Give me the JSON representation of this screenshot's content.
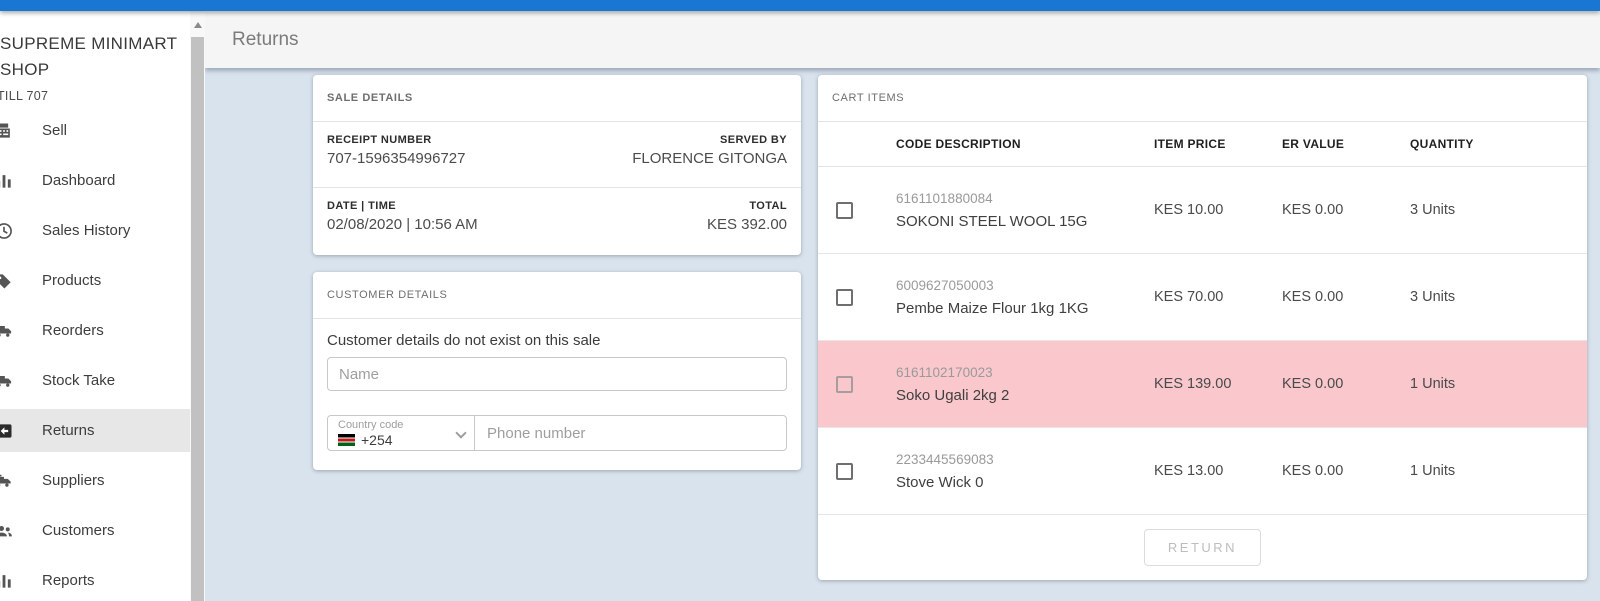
{
  "colors": {
    "topbar_blue": "#1976d2",
    "content_background": "#d9e3ee",
    "highlight_row_pink": "#f9c7cc",
    "active_nav_gray": "#e7e7e7"
  },
  "sidebar": {
    "store_name_line1": "SUPREME MINIMART",
    "store_name_line2": "SHOP",
    "till": "TILL 707",
    "items": [
      {
        "label": "Sell",
        "icon": "receipt-icon"
      },
      {
        "label": "Dashboard",
        "icon": "bar-chart-icon"
      },
      {
        "label": "Sales History",
        "icon": "clock-icon"
      },
      {
        "label": "Products",
        "icon": "tag-icon"
      },
      {
        "label": "Reorders",
        "icon": "truck-icon"
      },
      {
        "label": "Stock Take",
        "icon": "truck-icon"
      },
      {
        "label": "Returns",
        "icon": "return-box-icon",
        "active": true
      },
      {
        "label": "Suppliers",
        "icon": "truck-icon"
      },
      {
        "label": "Customers",
        "icon": "people-icon"
      },
      {
        "label": "Reports",
        "icon": "bar-chart-icon"
      }
    ]
  },
  "header": {
    "title": "Returns"
  },
  "sale_details": {
    "title": "SALE DETAILS",
    "receipt_number_label": "RECEIPT NUMBER",
    "receipt_number": "707-1596354996727",
    "served_by_label": "SERVED BY",
    "served_by": "FLORENCE GITONGA",
    "datetime_label": "DATE | TIME",
    "datetime": "02/08/2020 | 10:56 AM",
    "total_label": "TOTAL",
    "total": "KES 392.00"
  },
  "customer_details": {
    "title": "CUSTOMER DETAILS",
    "message": "Customer details do not exist on this sale",
    "name_placeholder": "Name",
    "country_code_label": "Country code",
    "country_code": "+254",
    "phone_placeholder": "Phone number"
  },
  "cart": {
    "title": "CART ITEMS",
    "columns": [
      "CODE DESCRIPTION",
      "ITEM PRICE",
      "ER VALUE",
      "QUANTITY"
    ],
    "items": [
      {
        "code": "6161101880084",
        "description": "SOKONI STEEL WOOL 15G",
        "item_price": "KES 10.00",
        "er_value": "KES 0.00",
        "quantity": "3 Units",
        "highlighted": false
      },
      {
        "code": "6009627050003",
        "description": "Pembe Maize Flour 1kg 1KG",
        "item_price": "KES 70.00",
        "er_value": "KES 0.00",
        "quantity": "3 Units",
        "highlighted": false
      },
      {
        "code": "6161102170023",
        "description": "Soko Ugali 2kg 2",
        "item_price": "KES 139.00",
        "er_value": "KES 0.00",
        "quantity": "1 Units",
        "highlighted": true
      },
      {
        "code": "2233445569083",
        "description": "Stove Wick 0",
        "item_price": "KES 13.00",
        "er_value": "KES 0.00",
        "quantity": "1 Units",
        "highlighted": false
      }
    ],
    "return_button_label": "RETURN"
  }
}
